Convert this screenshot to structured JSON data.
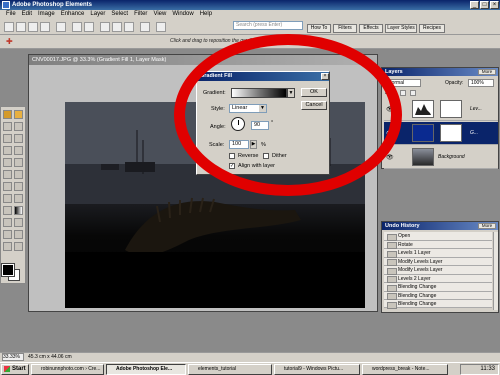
{
  "app": {
    "title": "Adobe Photoshop Elements"
  },
  "menu": [
    "File",
    "Edit",
    "Image",
    "Enhance",
    "Layer",
    "Select",
    "Filter",
    "View",
    "Window",
    "Help"
  ],
  "toolbar": {
    "search_placeholder": "Search (press Enter)",
    "tabs": [
      "How To",
      "Filters",
      "Effects",
      "Layer Styles",
      "Recipes"
    ],
    "hint": "Click and drag to reposition the gradient"
  },
  "document": {
    "title": "CNV00017.JPG @ 33.3% (Gradient Fill 1, Layer Mask)"
  },
  "dialog": {
    "title": "Gradient Fill",
    "gradient_label": "Gradient:",
    "style_label": "Style:",
    "style_value": "Linear",
    "angle_label": "Angle:",
    "angle_value": "90",
    "angle_unit": "°",
    "scale_label": "Scale:",
    "scale_value": "100",
    "scale_unit": "%",
    "reverse_label": "Reverse",
    "dither_label": "Dither",
    "align_label": "Align with layer",
    "reverse_checked": false,
    "dither_checked": false,
    "align_checked": true,
    "ok": "OK",
    "cancel": "Cancel"
  },
  "layers": {
    "title": "Layers",
    "more": "More",
    "mode": "Normal",
    "opacity_label": "Opacity:",
    "opacity_value": "100%",
    "lock_label": "Lock:",
    "rows": [
      {
        "name": "Lev..."
      },
      {
        "name": "G..."
      },
      {
        "name": "Background"
      }
    ]
  },
  "undo": {
    "title": "Undo History",
    "more": "More",
    "items": [
      "Open",
      "Rotate",
      "Levels 1 Layer",
      "Modify Levels Layer",
      "Modify Levels Layer",
      "Levels 2 Layer",
      "Blending Change",
      "Blending Change",
      "Blending Change"
    ]
  },
  "status": {
    "zoom": "33.33%",
    "docsize": "45.3 cm x 44.06 cm"
  },
  "taskbar": {
    "start": "Start",
    "tasks": [
      "robinunnphoto.com › Cre...",
      "Adobe Photoshop Ele...",
      "elements_tutorial",
      "tutorial9 - Windows Pictu...",
      "wordpress_break - Note..."
    ],
    "clock": "11:33"
  },
  "colors": {
    "annotation_circle": "#e00000",
    "title_bar": "#0a246a"
  }
}
